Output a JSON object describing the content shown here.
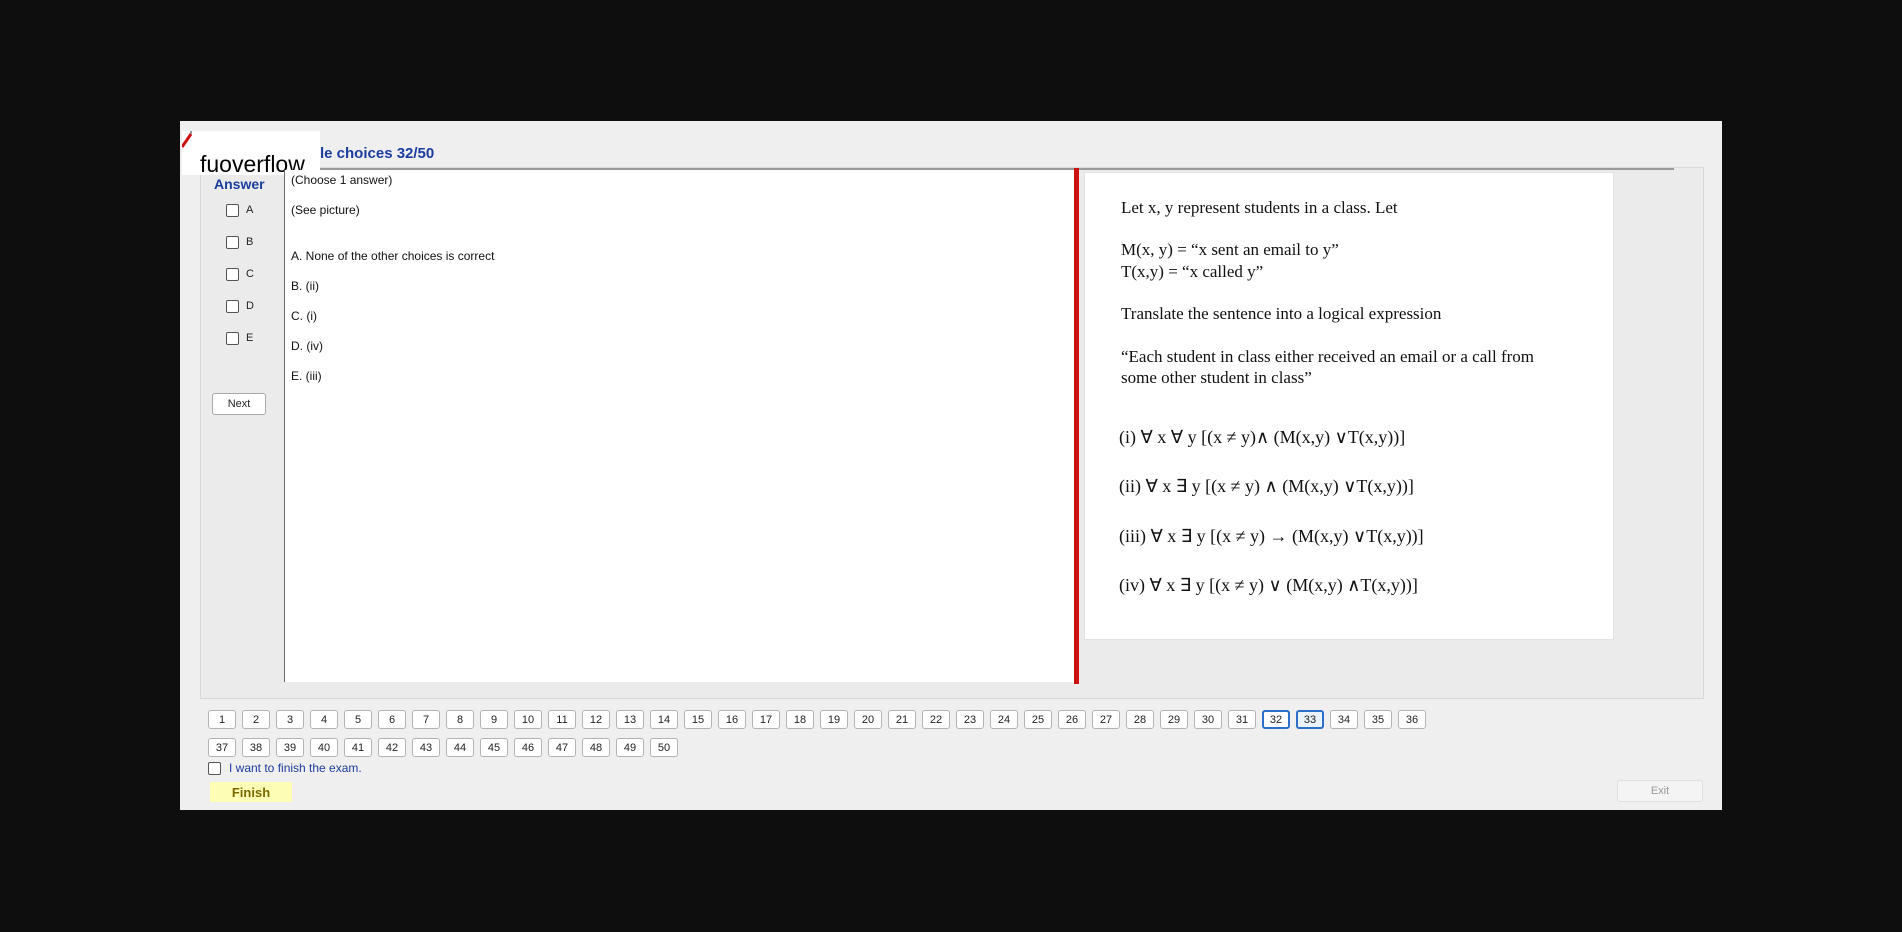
{
  "brand": {
    "logo_text": "fuoverflow"
  },
  "header": {
    "title": "le choices 32/50"
  },
  "answer_panel": {
    "title": "Answer",
    "options": [
      "A",
      "B",
      "C",
      "D",
      "E"
    ],
    "next_label": "Next"
  },
  "question": {
    "instruction": "(Choose 1 answer)",
    "picture_note": "(See picture)",
    "choices": [
      "A.  None of the other choices is correct",
      "B.  (ii)",
      "C.  (i)",
      "D.  (iv)",
      "E.  (iii)"
    ]
  },
  "picture": {
    "intro": "Let x, y represent students in a class.  Let",
    "def_m": "M(x, y) = “x sent an email to y”",
    "def_t": "T(x,y) = “x called y”",
    "task": "Translate the sentence into a logical expression",
    "sentence_line1": "“Each student in class either received an email or a call from",
    "sentence_line2": "some other student in class”",
    "expressions": [
      "(i)  ∀ x  ∀ y [(x ≠ y)∧ (M(x,y) ∨T(x,y))]",
      "(ii)  ∀ x  ∃ y [(x ≠ y) ∧ (M(x,y) ∨T(x,y))]",
      "(iii)  ∀ x  ∃ y [(x ≠ y) → (M(x,y) ∨T(x,y))]",
      "(iv)  ∀ x  ∃ y [(x ≠ y) ∨ (M(x,y) ∧T(x,y))]"
    ]
  },
  "pagination": {
    "pages": [
      "1",
      "2",
      "3",
      "4",
      "5",
      "6",
      "7",
      "8",
      "9",
      "10",
      "11",
      "12",
      "13",
      "14",
      "15",
      "16",
      "17",
      "18",
      "19",
      "20",
      "21",
      "22",
      "23",
      "24",
      "25",
      "26",
      "27",
      "28",
      "29",
      "30",
      "31",
      "32",
      "33",
      "34",
      "35",
      "36",
      "37",
      "38",
      "39",
      "40",
      "41",
      "42",
      "43",
      "44",
      "45",
      "46",
      "47",
      "48",
      "49",
      "50"
    ],
    "highlighted": "32",
    "current": "33"
  },
  "footer": {
    "finish_checkbox_label": "I want to finish the exam.",
    "finish_label": "Finish",
    "exit_label": "Exit"
  },
  "colors": {
    "accent_blue": "#1a3d9e",
    "divider_red": "#cc1111",
    "finish_yellow": "#fdfdb5"
  }
}
